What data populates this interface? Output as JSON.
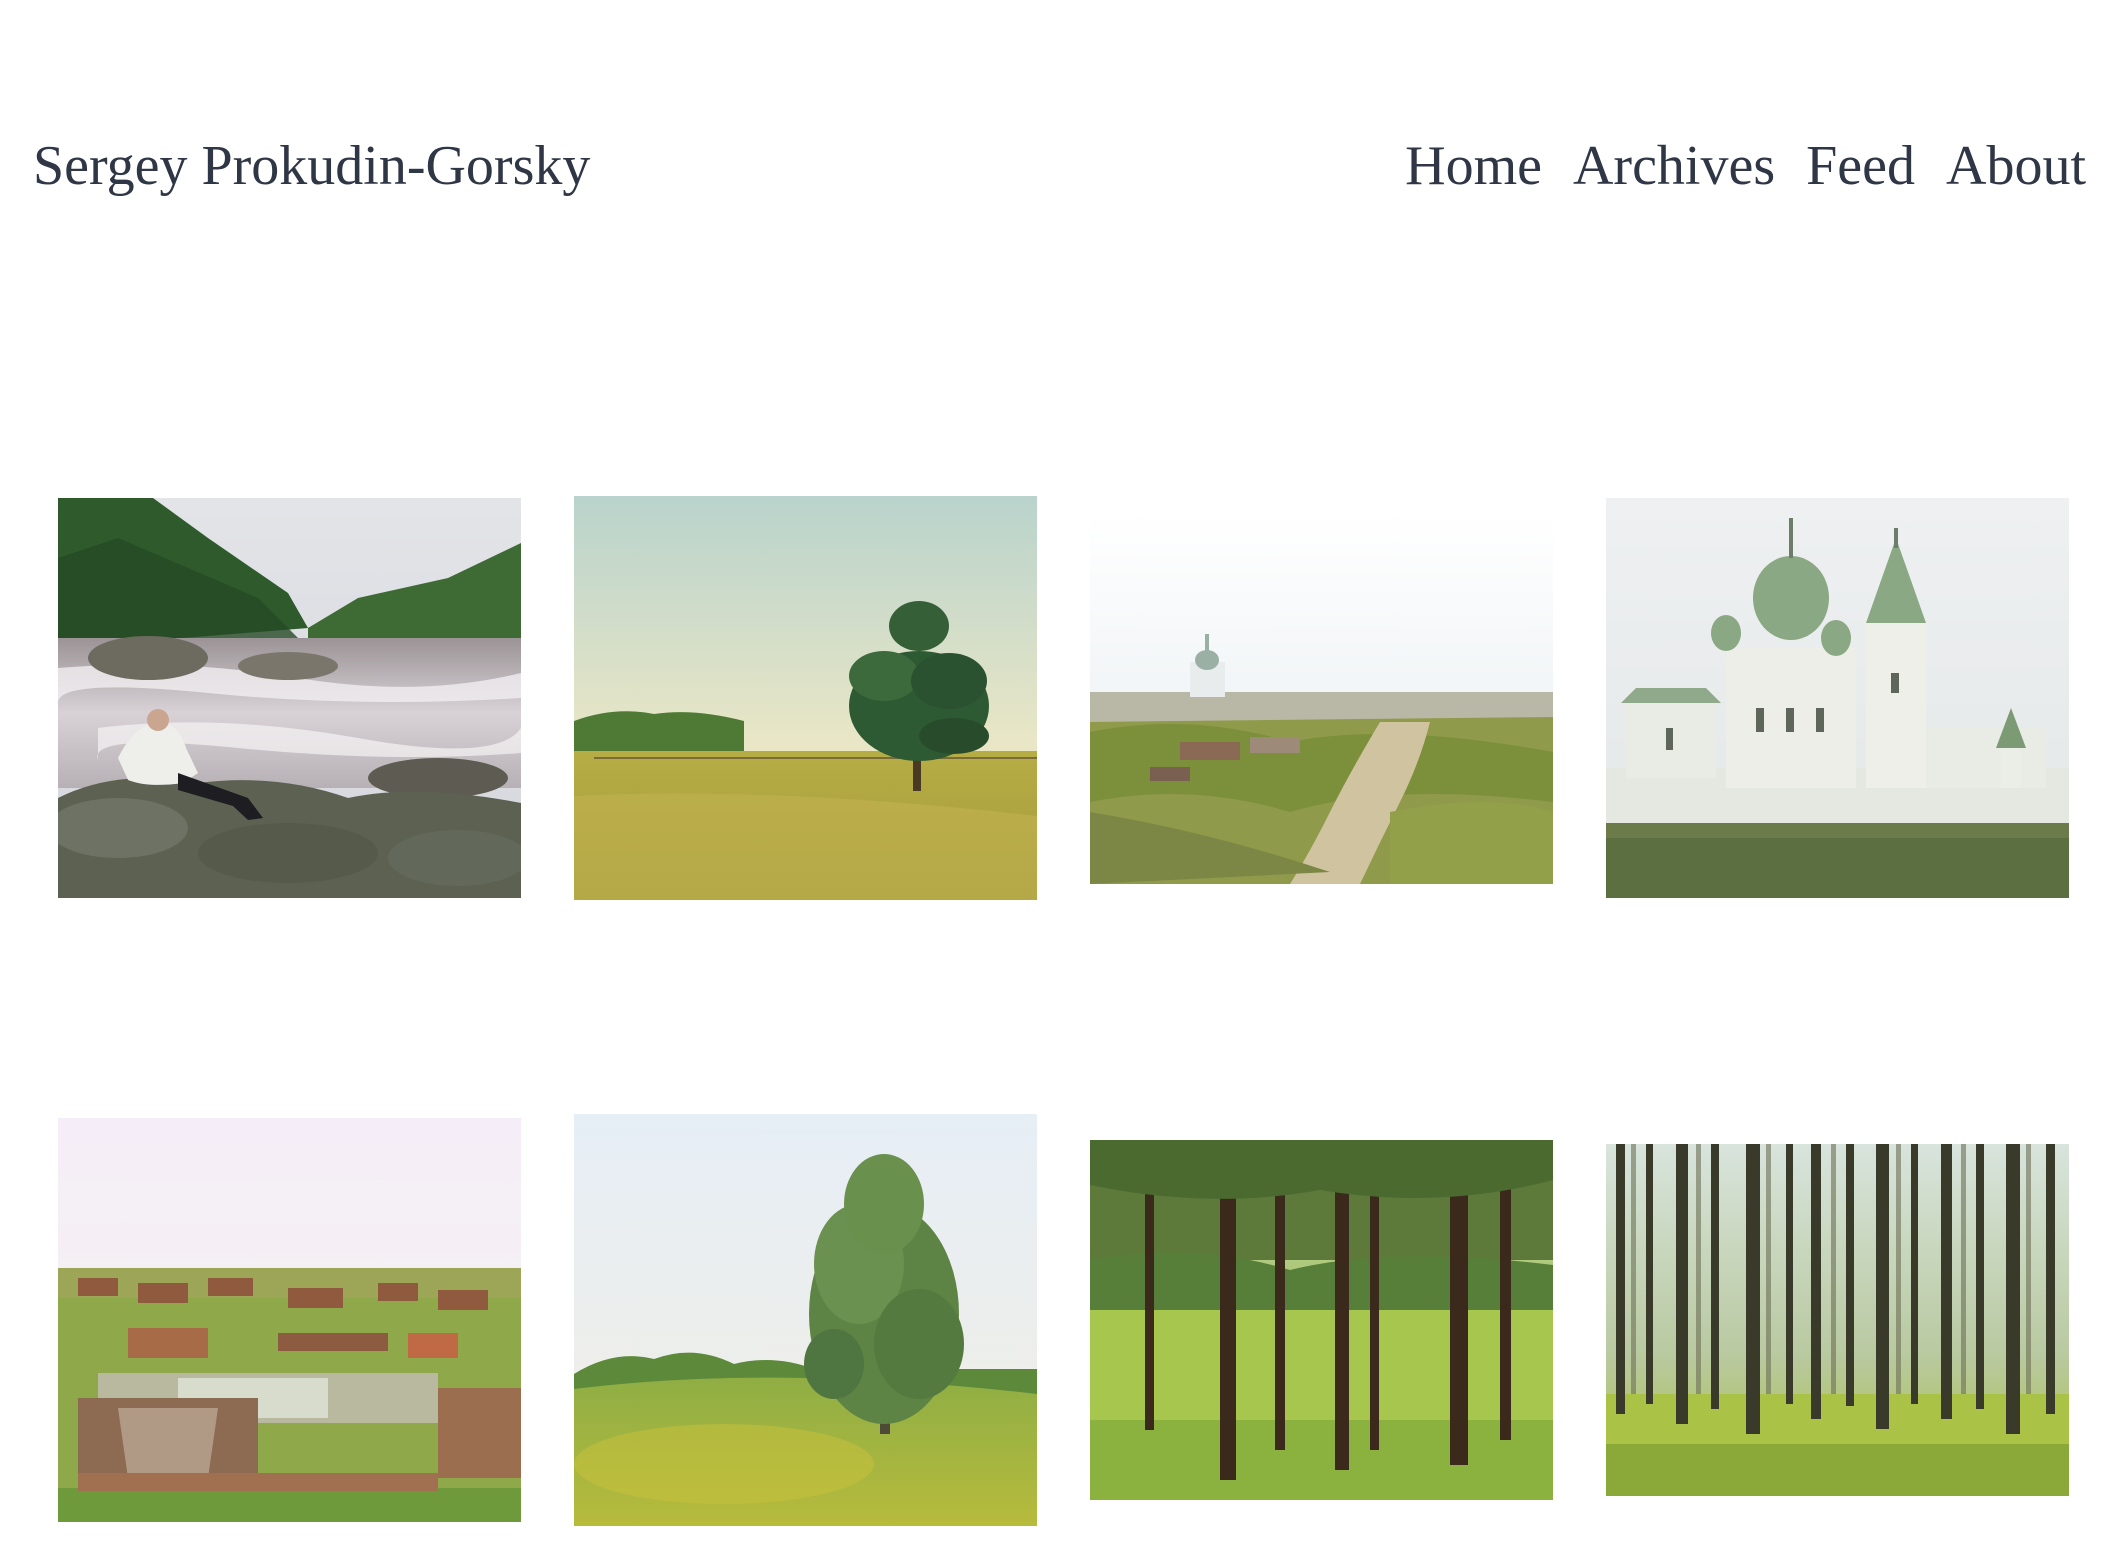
{
  "site": {
    "title": "Sergey Prokudin-Gorsky"
  },
  "nav": {
    "items": [
      "Home",
      "Archives",
      "Feed",
      "About"
    ]
  },
  "gallery": {
    "photos": [
      {
        "id": "river-rapids-man"
      },
      {
        "id": "lone-pine-meadow"
      },
      {
        "id": "village-church-road"
      },
      {
        "id": "white-monastery"
      },
      {
        "id": "wooden-village-pond"
      },
      {
        "id": "birch-tree-field"
      },
      {
        "id": "pine-forest-clearing"
      },
      {
        "id": "dense-pine-forest"
      }
    ]
  },
  "colors": {
    "text": "#2f3645",
    "background": "#ffffff"
  }
}
